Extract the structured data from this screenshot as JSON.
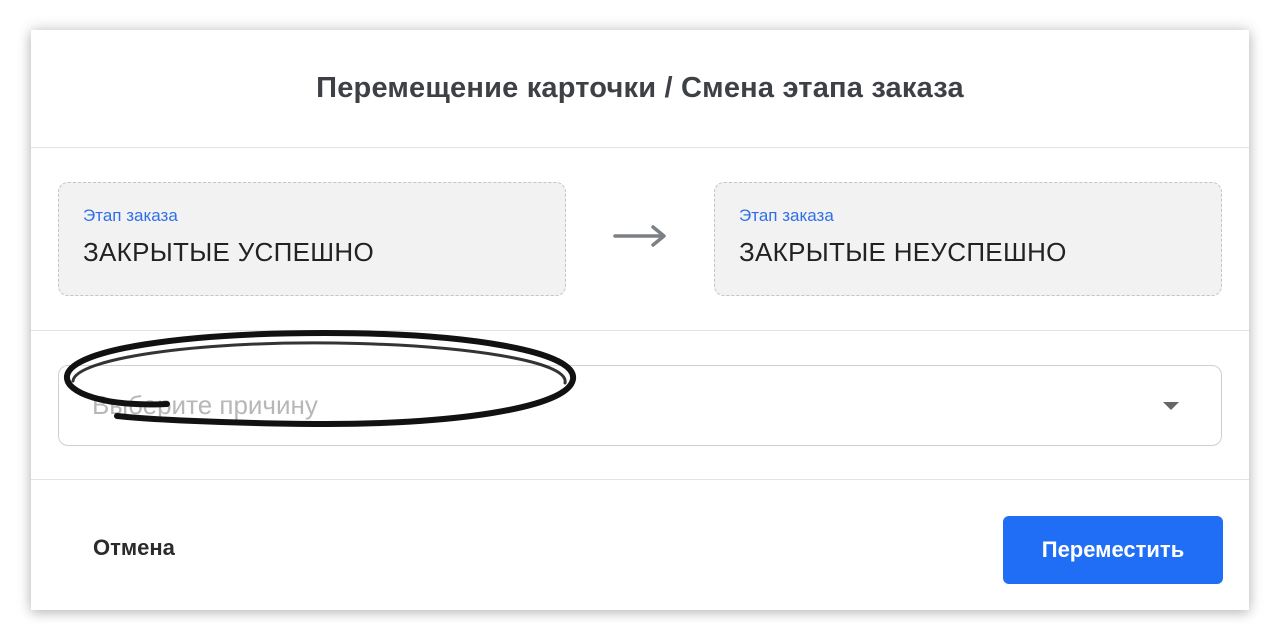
{
  "dialog": {
    "title": "Перемещение карточки / Смена этапа заказа"
  },
  "stages": {
    "from": {
      "label": "Этап заказа",
      "value": "ЗАКРЫТЫЕ УСПЕШНО"
    },
    "arrow_icon": "arrow-right-icon",
    "to": {
      "label": "Этап заказа",
      "value": "ЗАКРЫТЫЕ НЕУСПЕШНО"
    }
  },
  "reason": {
    "placeholder": "Выберите причину",
    "caret_icon": "caret-down-icon"
  },
  "footer": {
    "cancel_label": "Отмена",
    "submit_label": "Переместить"
  },
  "colors": {
    "accent": "#1f6ef5",
    "label_blue": "#2f6fe8",
    "title": "#3d4045",
    "stage_bg": "#f2f2f2"
  }
}
